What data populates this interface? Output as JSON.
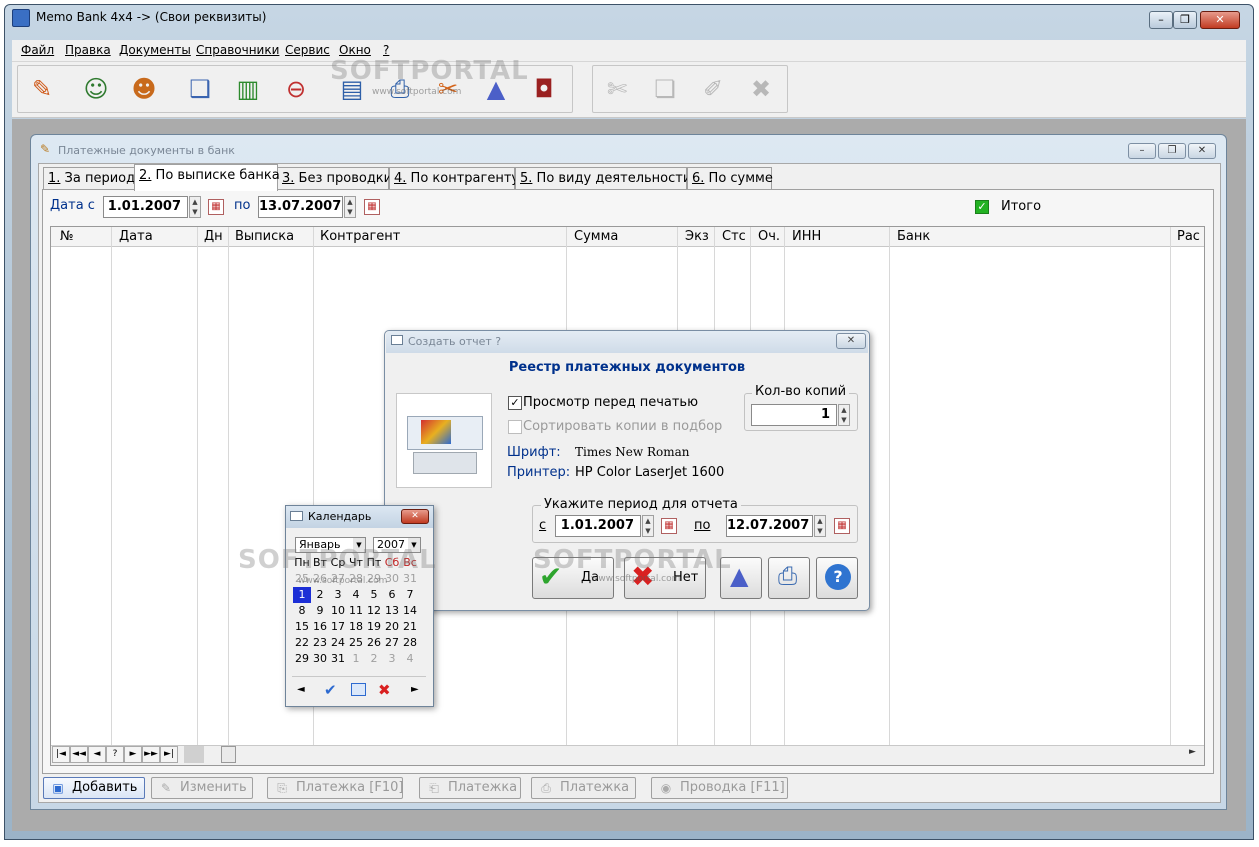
{
  "app": {
    "title": "Memo Bank 4x4 -> (Свои реквизиты)"
  },
  "menu": [
    "Файл",
    "Правка",
    "Документы",
    "Справочники",
    "Сервис",
    "Окно",
    "?"
  ],
  "child_window": {
    "title": "Платежные документы в банк"
  },
  "tabs": [
    {
      "num": "1.",
      "label": " За период"
    },
    {
      "num": "2.",
      "label": " По выписке банка"
    },
    {
      "num": "3.",
      "label": " Без проводки"
    },
    {
      "num": "4.",
      "label": " По контрагенту"
    },
    {
      "num": "5.",
      "label": " По виду деятельности"
    },
    {
      "num": "6.",
      "label": " По сумме"
    }
  ],
  "filter": {
    "date_from_label": "Дата с",
    "date_from": "1.01.2007",
    "to_label": "по",
    "date_to": "13.07.2007",
    "total_label": "Итого"
  },
  "grid": {
    "columns": [
      "№",
      "Дата",
      "Дн",
      "Выписка",
      "Контрагент",
      "Сумма",
      "Экз",
      "Стс",
      "Оч.",
      "ИНН",
      "Банк",
      "Рас"
    ]
  },
  "nav": [
    "|◄",
    "◄◄",
    "◄",
    "?",
    "►",
    "►►",
    "►|"
  ],
  "bottom_buttons": [
    {
      "label": "Добавить",
      "icon": "add-doc-icon",
      "enabled": true
    },
    {
      "label": "Изменить",
      "icon": "edit-icon",
      "enabled": false
    },
    {
      "label": "Платежка [F10]",
      "icon": "payment-icon",
      "enabled": false
    },
    {
      "label": "Платежка",
      "icon": "payment-2-icon",
      "enabled": false
    },
    {
      "label": "Платежка",
      "icon": "payment-3-icon",
      "enabled": false
    },
    {
      "label": "Проводка [F11]",
      "icon": "posting-icon",
      "enabled": false
    }
  ],
  "report_dialog": {
    "title": "Создать отчет ?",
    "heading": "Реестр платежных документов",
    "preview_label": "Просмотр перед печатью",
    "preview_checked": true,
    "sort_label": "Сортировать копии в подбор",
    "sort_checked": false,
    "copies_label": "Кол-во копий",
    "copies_value": "1",
    "font_label": "Шрифт:",
    "font_value": "Times New Roman",
    "printer_label": "Принтер:",
    "printer_value": "HP Color LaserJet 1600",
    "period_label": "Укажите период для отчета",
    "from_label": "с",
    "from_value": "1.01.2007",
    "to_label": "по",
    "to_value": "12.07.2007",
    "yes_label": "Да",
    "no_label": "Нет"
  },
  "calendar": {
    "title": "Календарь",
    "month": "Январь",
    "year": "2007",
    "weekdays": [
      "Пн",
      "Вт",
      "Ср",
      "Чт",
      "Пт",
      "Сб",
      "Вс"
    ],
    "weeks": [
      [
        "25",
        "26",
        "27",
        "28",
        "29",
        "30",
        "31"
      ],
      [
        "1",
        "2",
        "3",
        "4",
        "5",
        "6",
        "7"
      ],
      [
        "8",
        "9",
        "10",
        "11",
        "12",
        "13",
        "14"
      ],
      [
        "15",
        "16",
        "17",
        "18",
        "19",
        "20",
        "21"
      ],
      [
        "22",
        "23",
        "24",
        "25",
        "26",
        "27",
        "28"
      ],
      [
        "29",
        "30",
        "31",
        "1",
        "2",
        "3",
        "4"
      ]
    ],
    "selected_day": "1"
  },
  "watermarks": {
    "brand": "SOFTPORTAL",
    "url": "www.softportal.com"
  },
  "colors": {
    "label_blue": "#00318c",
    "check_green": "#23b223",
    "selected_day": "#1c2fd6",
    "weekend_red": "#c02020"
  }
}
